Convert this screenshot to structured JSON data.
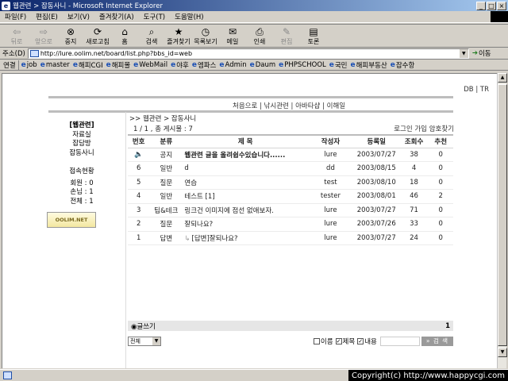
{
  "window": {
    "title": "웹관련 > 잡동사니 - Microsoft Internet Explorer",
    "buttons": [
      "_",
      "□",
      "×"
    ]
  },
  "menu": [
    "파일(F)",
    "편집(E)",
    "보기(V)",
    "즐겨찾기(A)",
    "도구(T)",
    "도움말(H)"
  ],
  "toolbar": [
    {
      "label": "뒤로",
      "icon": "back-arrow-icon",
      "glyph": "⇦",
      "enabled": false
    },
    {
      "label": "앞으로",
      "icon": "forward-arrow-icon",
      "glyph": "⇨",
      "enabled": false
    },
    {
      "label": "중지",
      "icon": "stop-icon",
      "glyph": "⊗",
      "enabled": true
    },
    {
      "label": "새로고침",
      "icon": "refresh-icon",
      "glyph": "⟳",
      "enabled": true
    },
    {
      "label": "홈",
      "icon": "home-icon",
      "glyph": "⌂",
      "enabled": true
    },
    {
      "label": "검색",
      "icon": "search-icon",
      "glyph": "⌕",
      "enabled": true
    },
    {
      "label": "즐겨찾기",
      "icon": "favorites-icon",
      "glyph": "★",
      "enabled": true
    },
    {
      "label": "목록보기",
      "icon": "history-icon",
      "glyph": "◷",
      "enabled": true
    },
    {
      "label": "메일",
      "icon": "mail-icon",
      "glyph": "✉",
      "enabled": true
    },
    {
      "label": "인쇄",
      "icon": "print-icon",
      "glyph": "⎙",
      "enabled": true
    },
    {
      "label": "편집",
      "icon": "edit-icon",
      "glyph": "✎",
      "enabled": false
    },
    {
      "label": "토론",
      "icon": "discuss-icon",
      "glyph": "▤",
      "enabled": true
    }
  ],
  "address": {
    "label": "주소(D)",
    "url": "http://lure.oolim.net/board/list.php?bbs_id=web",
    "go_label": "이동"
  },
  "links": {
    "label": "연결",
    "items": [
      "job",
      "master",
      "해피CGI",
      "해피몰",
      "WebMail",
      "야후",
      "엠파스",
      "Admin",
      "Daum",
      "PHPSCHOOL",
      "국민",
      "해피부동산",
      "잡수항"
    ]
  },
  "page": {
    "top_links": "DB | TR",
    "nav_links": "처음으로 | 낚시관련 | 아바타샵 | 이해일",
    "left_nav": {
      "section_title": "[웹관련]",
      "items": [
        "자료실",
        "잡담방",
        "잡동사니"
      ],
      "stats_title": "접속현황",
      "stats": [
        "회원 : 0",
        "손님 : 1",
        "전체 : 1"
      ],
      "banner": "OOLIM.NET"
    },
    "breadcrumb": ">> 웹관련 > 잡동사니",
    "summary": "1 / 1 , 총 게시물 : 7",
    "login_links": "로그인 가입 암호찾기",
    "table": {
      "headers": [
        "번호",
        "분류",
        "제 목",
        "작성자",
        "등록일",
        "조회수",
        "추천"
      ],
      "rows": [
        {
          "no": "🔈",
          "cat": "공지",
          "subject": "웹관련 글을 올려쉽수있습니다......",
          "author": "lure",
          "date": "2003/07/27",
          "views": "38",
          "rec": "0",
          "notice": true
        },
        {
          "no": "6",
          "cat": "일반",
          "subject": "d",
          "author": "dd",
          "date": "2003/08/15",
          "views": "4",
          "rec": "0"
        },
        {
          "no": "5",
          "cat": "질문",
          "subject": "연습",
          "author": "test",
          "date": "2003/08/10",
          "views": "18",
          "rec": "0"
        },
        {
          "no": "4",
          "cat": "일반",
          "subject": "테스트 [1]",
          "author": "tester",
          "date": "2003/08/01",
          "views": "46",
          "rec": "2"
        },
        {
          "no": "3",
          "cat": "팁&테크",
          "subject": "링크건 이미지에 점선 없애보자.",
          "author": "lure",
          "date": "2003/07/27",
          "views": "71",
          "rec": "0"
        },
        {
          "no": "2",
          "cat": "질문",
          "subject": "잘되나요?",
          "author": "lure",
          "date": "2003/07/26",
          "views": "33",
          "rec": "0"
        },
        {
          "no": "1",
          "cat": "답변",
          "subject": "[답변]잘되나요?",
          "author": "lure",
          "date": "2003/07/27",
          "views": "24",
          "rec": "0",
          "reply": true
        }
      ]
    },
    "write_label": "글쓰기",
    "page_number": "1",
    "search": {
      "select_value": "전체",
      "checks": [
        {
          "label": "이름",
          "checked": false
        },
        {
          "label": "제목",
          "checked": true
        },
        {
          "label": "내용",
          "checked": true
        }
      ],
      "button": "검 색"
    }
  },
  "status": {
    "copyright": "Copyright(c) http://www.happycgi.com"
  }
}
